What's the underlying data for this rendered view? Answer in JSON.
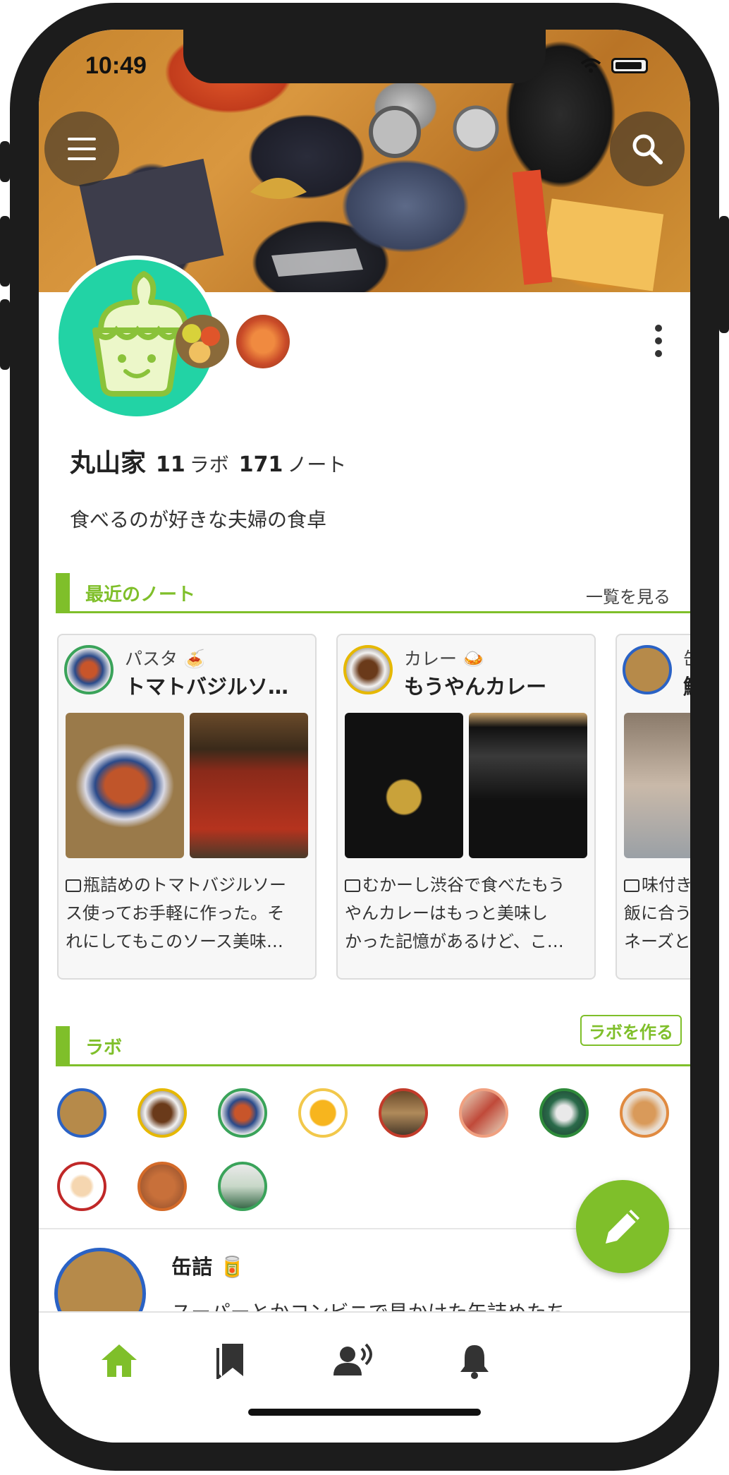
{
  "status_bar": {
    "time": "10:49"
  },
  "profile": {
    "name": "丸山家",
    "labs_count": "11",
    "labs_label": "ラボ",
    "notes_count": "171",
    "notes_label": "ノート",
    "bio": "食べるのが好きな夫婦の食卓"
  },
  "recent_notes": {
    "title": "最近のノート",
    "see_all": "一覧を見る",
    "cards": [
      {
        "category": "パスタ 🍝",
        "title": "トマトバジルソ…",
        "lines": [
          "瓶詰めのトマトバジルソー",
          "ス使ってお手軽に作った。そ",
          "れにしてもこのソース美味…"
        ],
        "ring": "#3aa35a"
      },
      {
        "category": "カレー 🍛",
        "title": "もうやんカレー",
        "lines": [
          "むかーし渋谷で食べたもう",
          "やんカレーはもっと美味し",
          "かった記憶があるけど、こ…"
        ],
        "ring": "#e6b800"
      },
      {
        "category": "缶",
        "title": "鯖",
        "lines": [
          "味付き",
          "飯に合う",
          "ネーズと"
        ],
        "ring": "#2a62c5"
      }
    ]
  },
  "labs": {
    "title": "ラボ",
    "create_label": "ラボを作る",
    "colors": [
      "#2a62c5",
      "#e6b800",
      "#3aa35a",
      "#f2c84b",
      "#c23b2a",
      "#f0a080",
      "#2e8a3a",
      "#e08a40",
      "#c02828",
      "#d46a28",
      "#3aa35a"
    ]
  },
  "lab_list": {
    "title": "缶詰 🥫",
    "desc": "スーパーとかコンビニで見かけた缶詰めたち"
  },
  "colors": {
    "accent": "#7fbf2a",
    "avatar_bg": "#22d3a5"
  },
  "nav": [
    "home-icon",
    "bookmark-icon",
    "people-icon",
    "bell-icon"
  ]
}
